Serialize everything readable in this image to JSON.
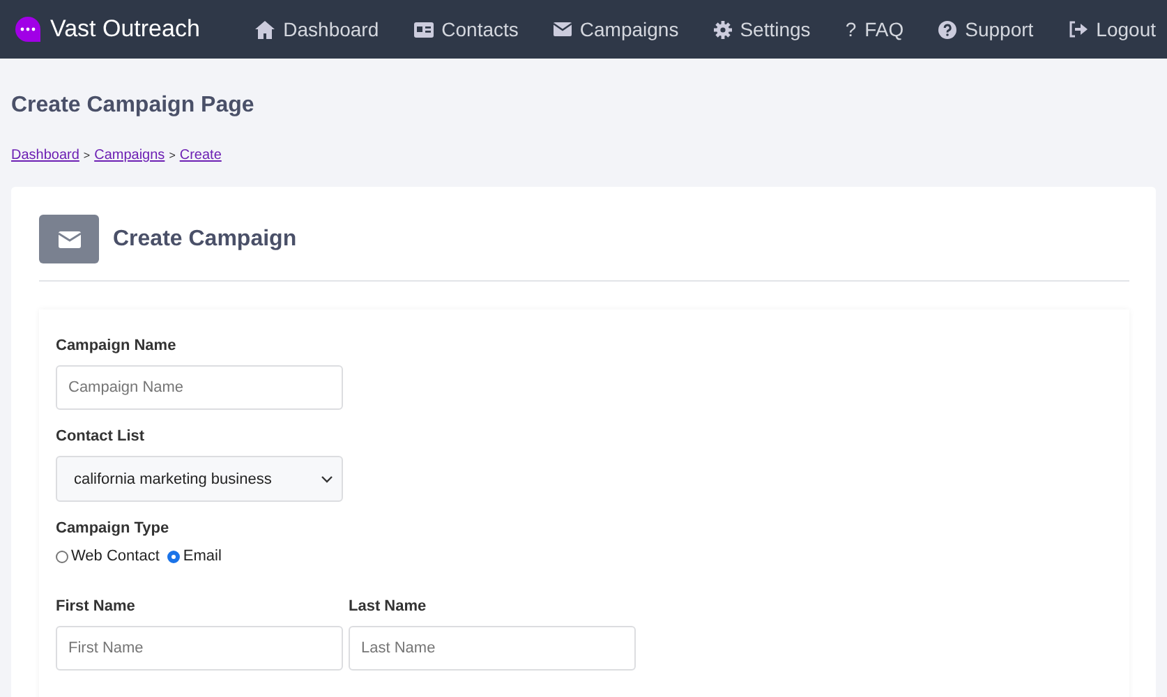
{
  "brand": {
    "name": "Vast Outreach"
  },
  "nav": [
    {
      "label": "Dashboard",
      "kind": "home"
    },
    {
      "label": "Contacts",
      "kind": "card"
    },
    {
      "label": "Campaigns",
      "kind": "mail"
    },
    {
      "label": "Settings",
      "kind": "gear"
    },
    {
      "label": "FAQ",
      "kind": "glyph",
      "glyph": "?"
    },
    {
      "label": "Support",
      "kind": "help"
    },
    {
      "label": "Logout",
      "kind": "logout"
    }
  ],
  "page_title": "Create Campaign Page",
  "breadcrumbs": [
    "Dashboard",
    "Campaigns",
    "Create"
  ],
  "breadcrumb_separator": ">",
  "card": {
    "title": "Create Campaign"
  },
  "form": {
    "campaign_name": {
      "label": "Campaign Name",
      "placeholder": "Campaign Name"
    },
    "contact_list": {
      "label": "Contact List",
      "value": "california marketing business"
    },
    "campaign_type": {
      "label": "Campaign Type",
      "options": [
        {
          "label": "Web Contact",
          "selected": false
        },
        {
          "label": "Email",
          "selected": true
        }
      ]
    },
    "names": [
      {
        "label": "First Name",
        "placeholder": "First Name"
      },
      {
        "label": "Last Name",
        "placeholder": "Last Name"
      }
    ]
  }
}
